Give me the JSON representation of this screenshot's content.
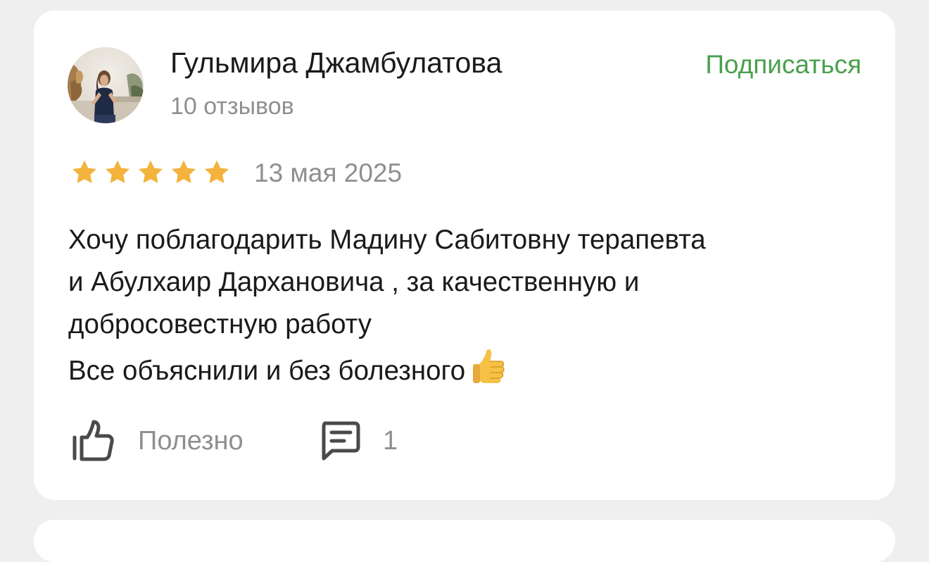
{
  "review": {
    "author": {
      "name": "Гульмира Джамбулатова",
      "reviews_count_text": "10 отзывов",
      "avatar_icon": "user-photo-avatar"
    },
    "subscribe_label": "Подписаться",
    "rating": {
      "value": 5,
      "max": 5,
      "star_color": "#f3b33d"
    },
    "date": "13 мая 2025",
    "text_lines": [
      "Хочу поблагодарить Мадину Сабитовну терапевта",
      "и Абулхаир Дархановича , за качественную и",
      "добросовестную работу",
      "Все объяснили и без болезного"
    ],
    "text_emoji_icon": "thumbs-up-emoji",
    "actions": {
      "helpful_label": "Полезно",
      "helpful_icon": "thumbs-up-outline-icon",
      "comments_count": "1",
      "comments_icon": "comment-icon"
    }
  },
  "colors": {
    "page_background": "#efefef",
    "card_background": "#ffffff",
    "accent_green": "#4aa04e",
    "text_primary": "#1a1a1a",
    "text_secondary": "#8f8f8f",
    "icon_gray": "#4a4a4a"
  }
}
